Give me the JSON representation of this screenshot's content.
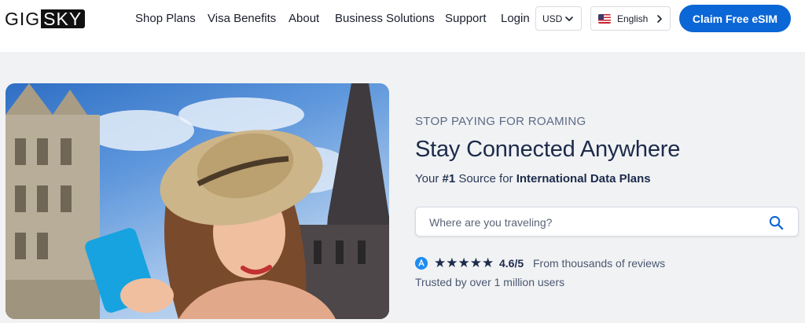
{
  "brand": {
    "logo_left": "GIG",
    "logo_right": "SKY"
  },
  "nav": {
    "items": [
      {
        "label": "Shop Plans"
      },
      {
        "label": "Visa Benefits"
      },
      {
        "label": "About"
      },
      {
        "label": "Business Solutions"
      },
      {
        "label": "Support"
      },
      {
        "label": "Login"
      }
    ]
  },
  "currency": {
    "selected": "USD",
    "icon": "chevron-down-icon"
  },
  "language": {
    "selected": "English",
    "flag": "us-flag-icon",
    "icon": "chevron-right-icon"
  },
  "cta": {
    "label": "Claim Free eSIM",
    "color": "#0b66d6"
  },
  "hero": {
    "eyebrow": "STOP PAYING FOR ROAMING",
    "headline": "Stay Connected Anywhere",
    "sub_prefix": "Your ",
    "sub_bold1": "#1",
    "sub_middle": " Source for ",
    "sub_bold2": "International Data Plans",
    "search_placeholder": "Where are you traveling?",
    "rating_stars": "★★★★★",
    "rating_value": "4.6/5",
    "rating_text": "From thousands of reviews",
    "trusted": "Trusted by over 1 million users"
  },
  "colors": {
    "accent": "#0b66d6",
    "text_dark": "#1c2b4b",
    "muted": "#5b6b85",
    "page_bg": "#f1f2f4"
  }
}
